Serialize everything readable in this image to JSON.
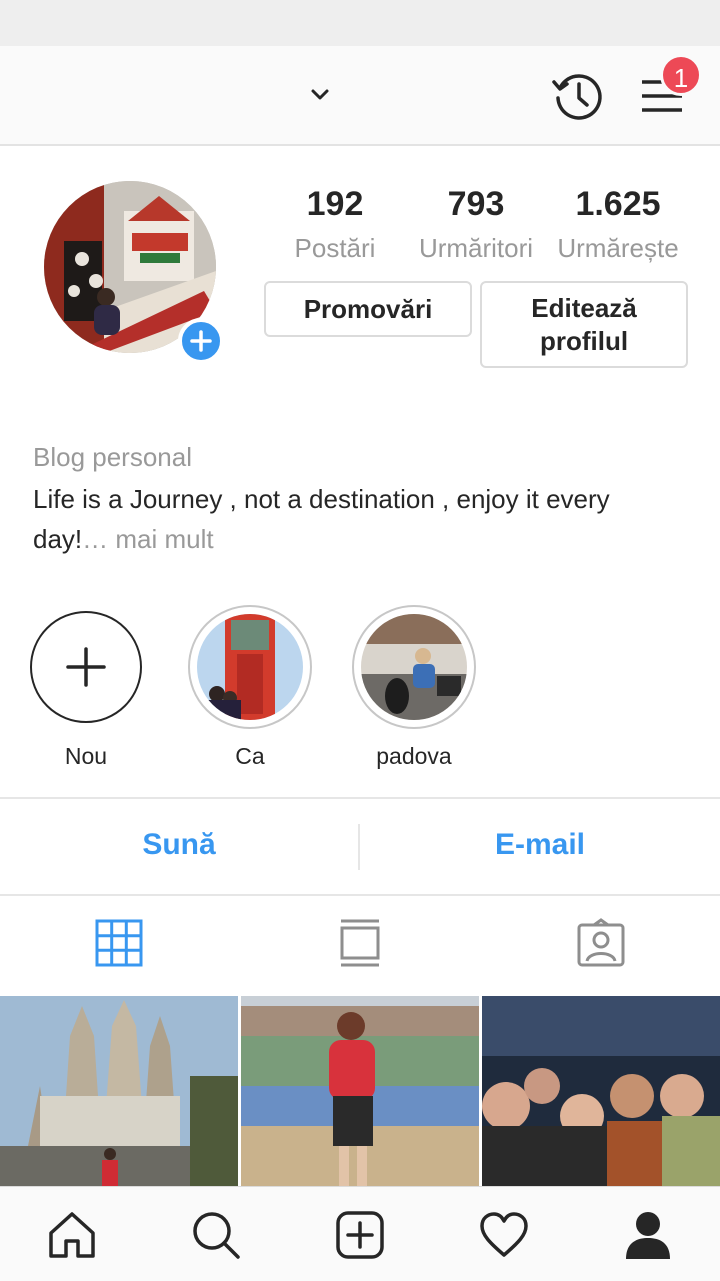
{
  "header": {
    "username": "",
    "notification_count": "1"
  },
  "profile": {
    "stats": [
      {
        "value": "192",
        "label": "Postări"
      },
      {
        "value": "793",
        "label": "Urmăritori"
      },
      {
        "value": "1.625",
        "label": "Urmărește"
      }
    ],
    "promote_label": "Promovări",
    "edit_label_line1": "Editează",
    "edit_label_line2": "profilul",
    "category": "Blog personal",
    "bio": "Life is a Journey , not a destination , enjoy it every day!",
    "bio_more": "… mai mult"
  },
  "highlights": [
    {
      "label": "Nou"
    },
    {
      "label": "Ca"
    },
    {
      "label": "padova"
    }
  ],
  "contact": {
    "call_label": "Sună",
    "email_label": "E-mail"
  },
  "colors": {
    "accent": "#3897f0",
    "badge": "#ed4956",
    "secondary_text": "#999999"
  },
  "icons": {
    "header": [
      "chevron-down-icon",
      "history-icon",
      "menu-icon"
    ],
    "tabs": [
      "grid-icon",
      "feed-icon",
      "tagged-icon"
    ],
    "nav": [
      "home-icon",
      "search-icon",
      "add-post-icon",
      "heart-icon",
      "profile-icon"
    ]
  }
}
